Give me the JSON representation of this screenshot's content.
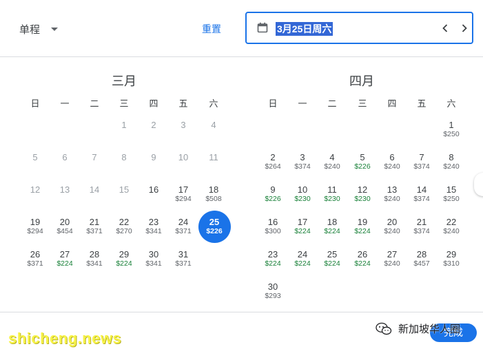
{
  "header": {
    "trip_type": "单程",
    "reset_label": "重置",
    "date_value": "3月25日周六"
  },
  "weekdays": [
    "日",
    "一",
    "二",
    "三",
    "四",
    "五",
    "六"
  ],
  "march": {
    "title": "三月",
    "days": {
      "1": "1",
      "2": "2",
      "3": "3",
      "4": "4",
      "5": "5",
      "6": "6",
      "7": "7",
      "8": "8",
      "9": "9",
      "10": "10",
      "11": "11",
      "12": "12",
      "13": "13",
      "14": "14",
      "15": "15",
      "16": "16",
      "17": "17",
      "18": "18",
      "19": "19",
      "20": "20",
      "21": "21",
      "22": "22",
      "23": "23",
      "24": "24",
      "25": "25",
      "26": "26",
      "27": "27",
      "28": "28",
      "29": "29",
      "30": "30",
      "31": "31"
    },
    "prices": {
      "17": "$294",
      "18": "$508",
      "19": "$294",
      "20": "$454",
      "21": "$371",
      "22": "$270",
      "23": "$341",
      "24": "$371",
      "25": "$226",
      "26": "$371",
      "27": "$224",
      "28": "$341",
      "29": "$224",
      "30": "$341",
      "31": "$371"
    }
  },
  "april": {
    "title": "四月",
    "days": {
      "1": "1",
      "2": "2",
      "3": "3",
      "4": "4",
      "5": "5",
      "6": "6",
      "7": "7",
      "8": "8",
      "9": "9",
      "10": "10",
      "11": "11",
      "12": "12",
      "13": "13",
      "14": "14",
      "15": "15",
      "16": "16",
      "17": "17",
      "18": "18",
      "19": "19",
      "20": "20",
      "21": "21",
      "22": "22",
      "23": "23",
      "24": "24",
      "25": "25",
      "26": "26",
      "27": "27",
      "28": "28",
      "29": "29",
      "30": "30"
    },
    "prices": {
      "1": "$250",
      "2": "$264",
      "3": "$374",
      "4": "$240",
      "5": "$226",
      "6": "$240",
      "7": "$374",
      "8": "$240",
      "9": "$226",
      "10": "$230",
      "11": "$230",
      "12": "$230",
      "13": "$240",
      "14": "$374",
      "15": "$250",
      "16": "$300",
      "17": "$224",
      "18": "$224",
      "19": "$224",
      "20": "$240",
      "21": "$374",
      "22": "$240",
      "23": "$224",
      "24": "$224",
      "25": "$224",
      "26": "$224",
      "27": "$240",
      "28": "$457",
      "29": "$310",
      "30": "$293"
    }
  },
  "footer": {
    "watermark": "shicheng.news",
    "wechat_account": "新加坡华人圈",
    "done_label": "完成"
  },
  "colors": {
    "accent": "#1a73e8",
    "low_price": "#188038",
    "past_day": "#9aa0a6",
    "watermark": "#f7f34a"
  }
}
